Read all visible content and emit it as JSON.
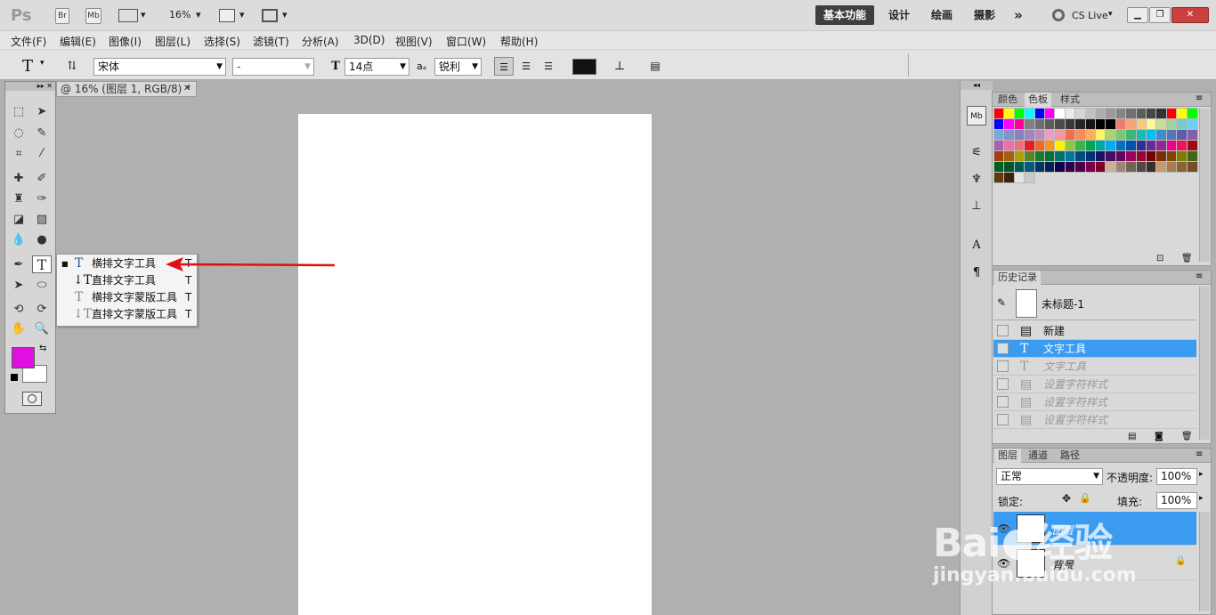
{
  "app": {
    "logo": "Ps",
    "zoom": "16%"
  },
  "titlebar": {
    "bridge": "Br",
    "minibridge": "Mb",
    "workspaces": [
      "基本功能",
      "设计",
      "绘画",
      "摄影"
    ],
    "more": "»",
    "cslive": "CS Live"
  },
  "menus": [
    "文件(F)",
    "编辑(E)",
    "图像(I)",
    "图层(L)",
    "选择(S)",
    "滤镜(T)",
    "分析(A)",
    "3D(D)",
    "视图(V)",
    "窗口(W)",
    "帮助(H)"
  ],
  "options": {
    "tool_icon": "T",
    "font_family": "宋体",
    "font_style": "-",
    "font_size": "14点",
    "aa_label": "aₐ",
    "antialias": "锐利",
    "color": "#111111"
  },
  "document": {
    "tab_title": "@ 16% (图层 1, RGB/8) *"
  },
  "flyout": {
    "items": [
      {
        "label": "横排文字工具",
        "key": "T"
      },
      {
        "label": "直排文字工具",
        "key": "T"
      },
      {
        "label": "横排文字蒙版工具",
        "key": "T"
      },
      {
        "label": "直排文字蒙版工具",
        "key": "T"
      }
    ]
  },
  "colors": {
    "foreground": "#e011e0",
    "background": "#ffffff",
    "accent": "#3a9bf0",
    "arrow": "#e01010"
  },
  "swatches_panel": {
    "tabs": [
      "颜色",
      "色板",
      "样式"
    ]
  },
  "history_panel": {
    "title": "历史记录",
    "snapshot": "未标题-1",
    "items": [
      {
        "label": "新建",
        "state": "active"
      },
      {
        "label": "文字工具",
        "state": "selected"
      },
      {
        "label": "文字工具",
        "state": "undone"
      },
      {
        "label": "设置字符样式",
        "state": "undone"
      },
      {
        "label": "设置字符样式",
        "state": "undone"
      },
      {
        "label": "设置字符样式",
        "state": "undone"
      }
    ]
  },
  "layers_panel": {
    "tabs": [
      "图层",
      "通道",
      "路径"
    ],
    "blend_mode": "正常",
    "opacity_label": "不透明度:",
    "opacity": "100%",
    "lock_label": "锁定:",
    "fill_label": "填充:",
    "fill": "100%",
    "layers": [
      {
        "name": "图层",
        "selected": true
      },
      {
        "name": "背景",
        "selected": false
      }
    ]
  },
  "watermark": {
    "brand_left": "Bai",
    "brand_right": "经验",
    "url": "jingyan.baidu.com"
  }
}
